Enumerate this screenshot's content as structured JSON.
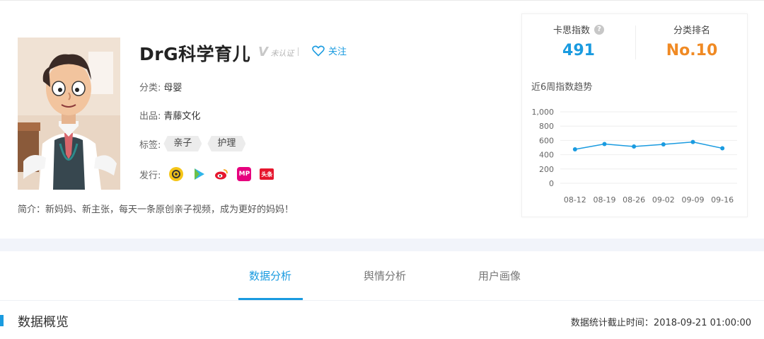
{
  "profile": {
    "name": "DrG科学育儿",
    "verify_mark": "V",
    "verify_text": "未认证",
    "follow_label": "关注",
    "category_label": "分类:",
    "category_value": "母婴",
    "producer_label": "出品:",
    "producer_value": "青藤文化",
    "tags_label": "标签:",
    "tags": [
      "亲子",
      "护理"
    ],
    "publish_label": "发行:",
    "platforms": [
      {
        "icon": "circle-camera-icon",
        "color": "#f5c518"
      },
      {
        "icon": "play-triangle-icon",
        "color": "#2fb5e9"
      },
      {
        "icon": "weibo-icon",
        "color": "#e6162d"
      },
      {
        "icon": "mp-icon",
        "color": "#e6007e",
        "text": "MP"
      },
      {
        "icon": "toutiao-icon",
        "color": "#e6162d",
        "text": "头条"
      }
    ],
    "intro": "简介：新妈妈、新主张，每天一条原创亲子视频，成为更好的妈妈！"
  },
  "stats": {
    "index_label": "卡思指数",
    "index_help": "?",
    "index_value": "491",
    "rank_label": "分类排名",
    "rank_value": "No.10",
    "index_color": "#1a9be0",
    "rank_color": "#f08a24",
    "trend_title": "近6周指数趋势"
  },
  "chart_data": {
    "type": "line",
    "categories": [
      "08-12",
      "08-19",
      "08-26",
      "09-02",
      "09-09",
      "09-16"
    ],
    "values": [
      475,
      550,
      515,
      545,
      578,
      490
    ],
    "ylim": [
      0,
      1000
    ],
    "yticks": [
      "1,000",
      "800",
      "600",
      "400",
      "200",
      "0"
    ],
    "line_color": "#1a9be0",
    "grid": true
  },
  "tabs": [
    "数据分析",
    "舆情分析",
    "用户画像"
  ],
  "section": {
    "title": "数据概览",
    "stat_time": "数据统计截止时间：2018-09-21 01:00:00"
  }
}
